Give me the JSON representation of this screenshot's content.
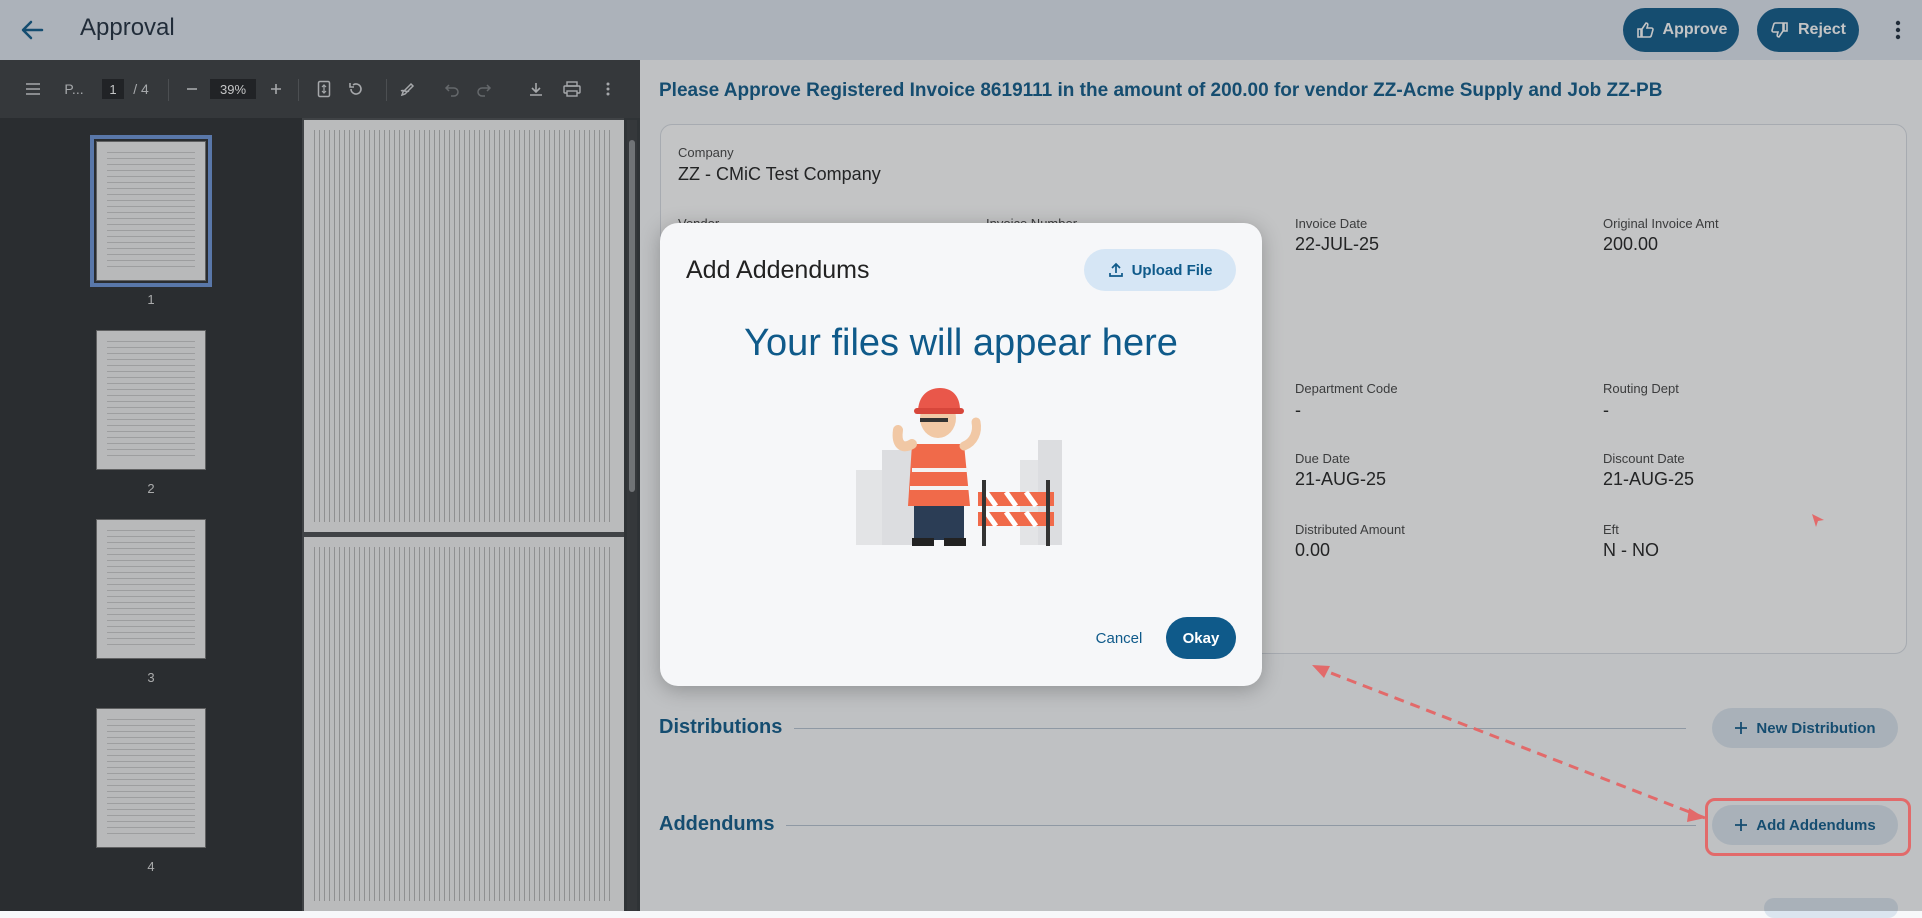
{
  "header": {
    "title": "Approval",
    "approve_label": "Approve",
    "reject_label": "Reject",
    "icons": [
      "arrow-left-icon",
      "thumbs-up-icon",
      "thumbs-down-icon",
      "more-vertical-icon"
    ]
  },
  "pdf_viewer": {
    "doc_name": "P...",
    "current_page": "1",
    "total_pages": "/ 4",
    "zoom": "39%",
    "thumbnails": [
      {
        "label": "1"
      },
      {
        "label": "2"
      },
      {
        "label": "3"
      },
      {
        "label": "4"
      }
    ]
  },
  "main": {
    "headline": "Please Approve Registered Invoice 8619111 in the amount of 200.00 for vendor ZZ-Acme Supply and Job ZZ-PB",
    "fields": {
      "company_label": "Company",
      "company_value": "ZZ - CMiC Test Company",
      "vendor_label": "Vendor",
      "invoice_number_label": "Invoice Number",
      "invoice_date_label": "Invoice Date",
      "invoice_date_value": "22-JUL-25",
      "original_amt_label": "Original Invoice Amt",
      "original_amt_value": "200.00",
      "dept_code_label": "Department Code",
      "dept_code_value": "-",
      "routing_dept_label": "Routing Dept",
      "routing_dept_value": "-",
      "due_date_label": "Due Date",
      "due_date_value": "21-AUG-25",
      "discount_date_label": "Discount Date",
      "discount_date_value": "21-AUG-25",
      "distributed_label": "Distributed Amount",
      "distributed_value": "0.00",
      "eft_label": "Eft",
      "eft_value": "N - NO"
    },
    "distributions_title": "Distributions",
    "new_distribution_label": "New Distribution",
    "addendums_title": "Addendums",
    "add_addendums_label": "Add Addendums"
  },
  "modal": {
    "title": "Add Addendums",
    "upload_label": "Upload File",
    "empty_text": "Your files will appear here",
    "cancel_label": "Cancel",
    "okay_label": "Okay"
  },
  "colors": {
    "primary": "#0f5a8a",
    "header_bg": "#dfe7f0",
    "annotation": "#e26a6a"
  }
}
